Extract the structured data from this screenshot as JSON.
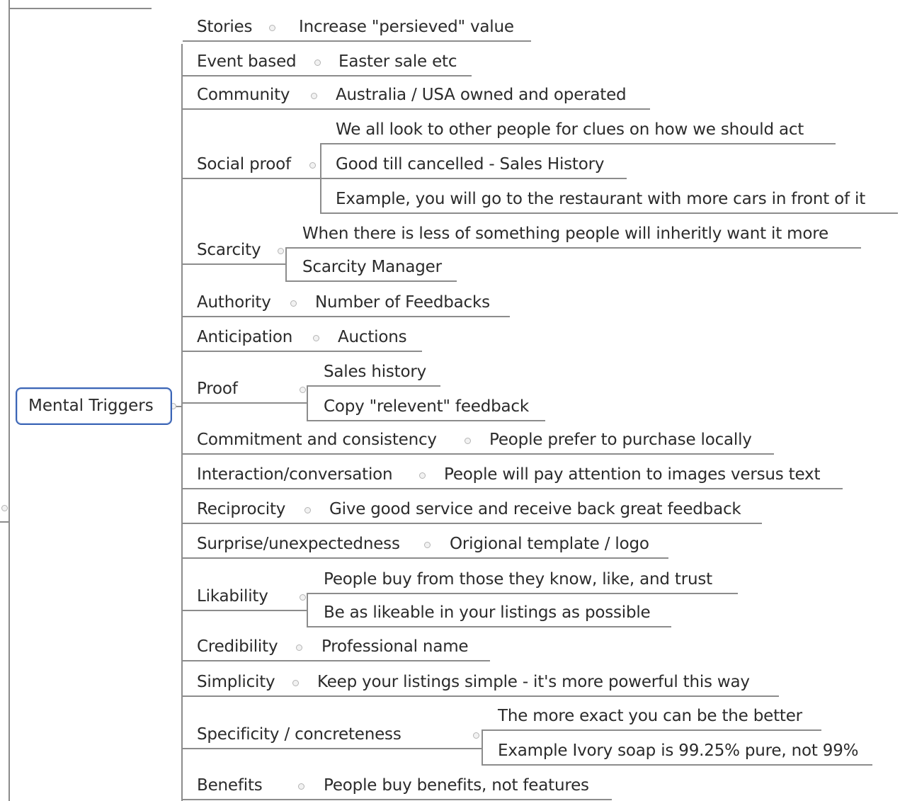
{
  "root": {
    "label": "Mental Triggers"
  },
  "branches": [
    {
      "label": "Stories",
      "children": [
        "Increase \"persieved\" value"
      ]
    },
    {
      "label": "Event based",
      "children": [
        "Easter sale etc"
      ]
    },
    {
      "label": "Community",
      "children": [
        "Australia / USA owned and operated"
      ]
    },
    {
      "label": "Social proof",
      "children": [
        "We all look to other people for clues on how we should act",
        "Good till cancelled - Sales History",
        "Example, you will go to the restaurant with more cars in front of it"
      ]
    },
    {
      "label": "Scarcity",
      "children": [
        "When there is less of something people will inheritly want it more",
        "Scarcity Manager"
      ]
    },
    {
      "label": "Authority",
      "children": [
        "Number of Feedbacks"
      ]
    },
    {
      "label": "Anticipation",
      "children": [
        "Auctions"
      ]
    },
    {
      "label": "Proof",
      "children": [
        "Sales history",
        "Copy \"relevent\" feedback"
      ]
    },
    {
      "label": "Commitment and consistency",
      "children": [
        "People prefer to purchase locally"
      ]
    },
    {
      "label": "Interaction/conversation",
      "children": [
        "People will pay attention to images versus text"
      ]
    },
    {
      "label": "Reciprocity",
      "children": [
        "Give good service and receive back great feedback"
      ]
    },
    {
      "label": "Surprise/unexpectedness",
      "children": [
        "Origional template / logo"
      ]
    },
    {
      "label": "Likability",
      "children": [
        "People buy from those they know, like, and trust",
        "Be as likeable in your listings as possible"
      ]
    },
    {
      "label": "Credibility",
      "children": [
        "Professional name"
      ]
    },
    {
      "label": "Simplicity",
      "children": [
        "Keep your listings simple - it's more powerful this way"
      ]
    },
    {
      "label": "Specificity / concreteness",
      "children": [
        "The more exact you can be the better",
        "Example Ivory soap is 99.25% pure, not 99%"
      ]
    },
    {
      "label": "Benefits",
      "children": [
        "People buy benefits, not features"
      ]
    }
  ]
}
